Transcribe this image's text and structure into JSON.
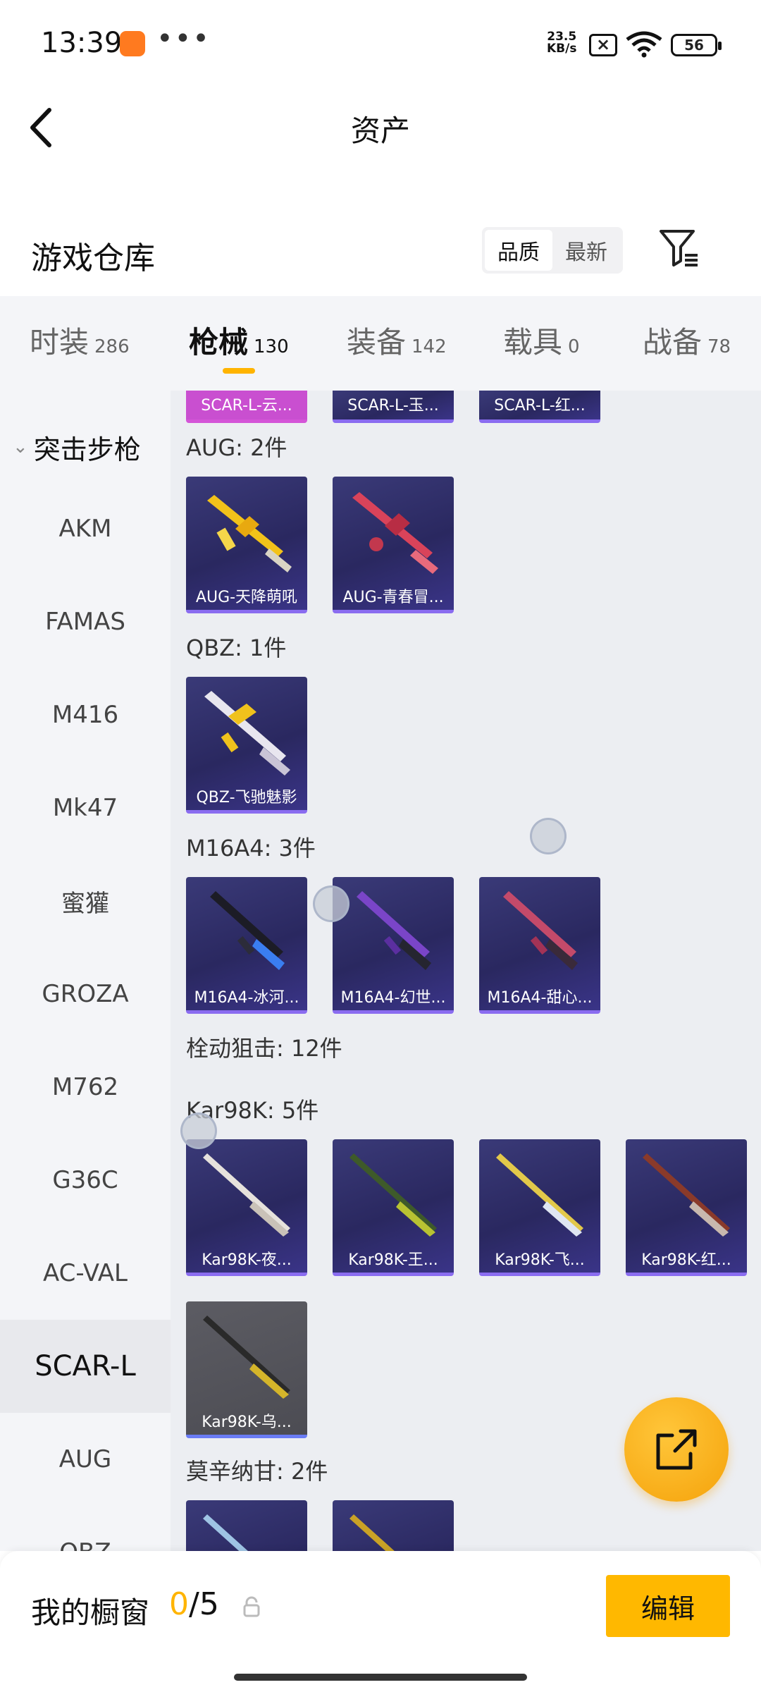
{
  "status_bar": {
    "time": "13:39",
    "dots": "•••",
    "speed_value": "23.5",
    "speed_unit": "KB/s",
    "battery": "56"
  },
  "header": {
    "title": "资产",
    "back_icon": "chevron-left-icon"
  },
  "warehouse": {
    "title": "游戏仓库",
    "sort_options": [
      "品质",
      "最新"
    ],
    "sort_selected": "品质",
    "filter_icon": "filter-icon"
  },
  "tabs": [
    {
      "label": "时装",
      "count": "286"
    },
    {
      "label": "枪械",
      "count": "130",
      "active": true
    },
    {
      "label": "装备",
      "count": "142"
    },
    {
      "label": "载具",
      "count": "0"
    },
    {
      "label": "战备",
      "count": "78"
    }
  ],
  "sidebar": {
    "group": "突击步枪",
    "items": [
      "AKM",
      "FAMAS",
      "M416",
      "Mk47",
      "蜜獾",
      "GROZA",
      "M762",
      "G36C",
      "AC-VAL",
      "SCAR-L",
      "AUG",
      "QBZ"
    ],
    "active": "SCAR-L"
  },
  "content": {
    "top_partial": [
      "SCAR-L-云...",
      "SCAR-L-玉...",
      "SCAR-L-红..."
    ],
    "aug_title": "AUG: 2件",
    "aug_items": [
      "AUG-天降萌吼",
      "AUG-青春冒..."
    ],
    "qbz_title": "QBZ: 1件",
    "qbz_items": [
      "QBZ-飞驰魅影"
    ],
    "m16_title": "M16A4: 3件",
    "m16_items": [
      "M16A4-冰河...",
      "M16A4-幻世...",
      "M16A4-甜心..."
    ],
    "sniper_title": "栓动狙击: 12件",
    "kar_title": "Kar98K: 5件",
    "kar_items": [
      "Kar98K-夜...",
      "Kar98K-王...",
      "Kar98K-飞...",
      "Kar98K-红...",
      "Kar98K-乌..."
    ],
    "mosin_title": "莫辛纳甘: 2件"
  },
  "showcase": {
    "label": "我的橱窗",
    "current": "0",
    "separator": "/",
    "max": "5",
    "edit_label": "编辑"
  },
  "colors": {
    "accent": "#ffb400",
    "card_bg": "#2a2860",
    "card_edge": "#8a6cf0"
  }
}
